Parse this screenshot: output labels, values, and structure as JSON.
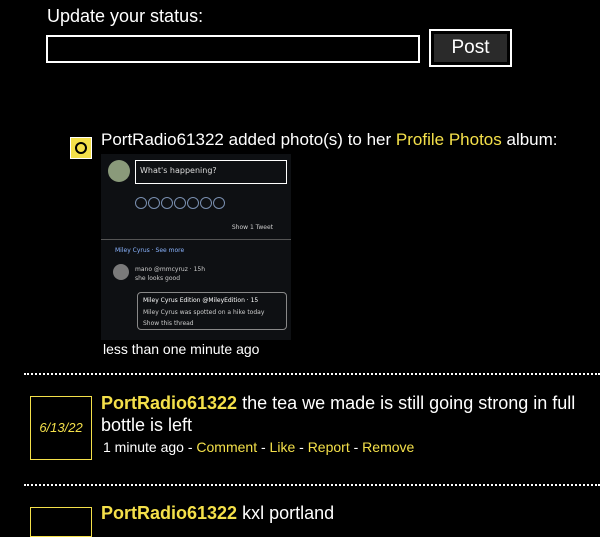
{
  "status": {
    "label": "Update your status:",
    "input_value": "",
    "input_placeholder": "",
    "post_label": "Post"
  },
  "activity": {
    "user": "PortRadio61322",
    "text_mid": "added photo(s) to her",
    "album_link": "Profile Photos",
    "text_end": "album:",
    "time": "less than one minute ago",
    "thumbnail": {
      "composer_placeholder": "What's happening?",
      "show_tweets": "Show 1 Tweet",
      "topic": "Miley Cyrus · See more",
      "reply_header": "mano @mmcyruz · 15h",
      "reply_body": "she looks good",
      "quote_author": "Miley Cyrus Edition @MileyEdition · 15",
      "quote_text": "Miley Cyrus was spotted on a hike today",
      "show_thread": "Show this thread"
    }
  },
  "posts": [
    {
      "date": "6/13/22",
      "user": "PortRadio61322",
      "text": "the tea we made is still going strong in full bottle is left",
      "time": "1 minute ago",
      "actions": [
        "Comment",
        "Like",
        "Report",
        "Remove"
      ]
    },
    {
      "user": "PortRadio61322",
      "text": "kxl portland"
    }
  ],
  "colors": {
    "background": "#000000",
    "accent": "#f4e04a",
    "text": "#ffffff"
  }
}
